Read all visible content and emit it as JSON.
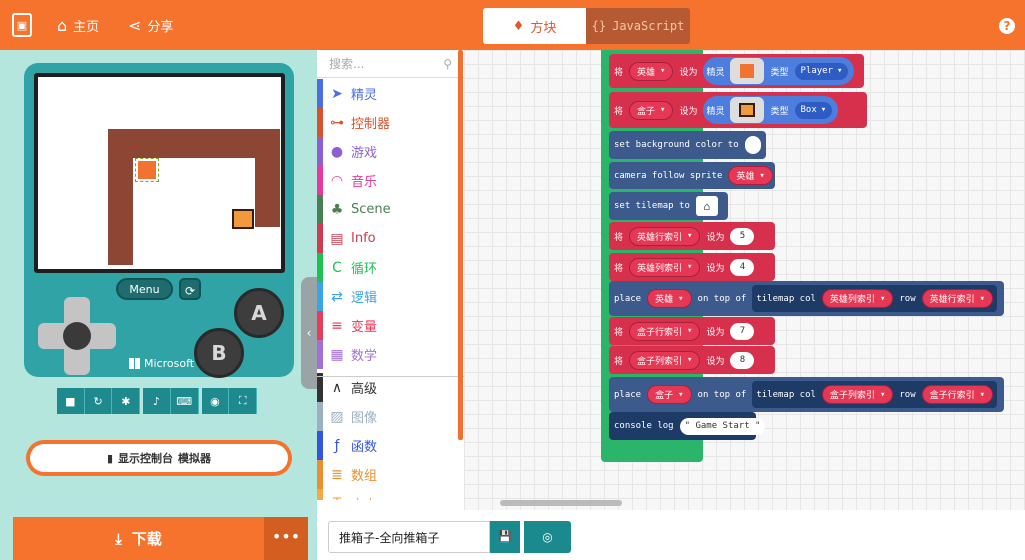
{
  "header": {
    "home_label": "主页",
    "share_label": "分享",
    "tab_blocks": "方块",
    "tab_js": "JavaScript",
    "tab_js_icon": "{}",
    "help": "?"
  },
  "simulator": {
    "menu_label": "Menu",
    "a_label": "A",
    "b_label": "B",
    "brand": "Microsoft",
    "console_label": "显示控制台",
    "console_sub": "模拟器",
    "download_label": "下载",
    "more_label": "•••"
  },
  "toolbox": {
    "search_placeholder": "搜索...",
    "categories": [
      {
        "label": "精灵",
        "color": "#4b6fe0"
      },
      {
        "label": "控制器",
        "color": "#d5542f"
      },
      {
        "label": "游戏",
        "color": "#8d5fd3"
      },
      {
        "label": "音乐",
        "color": "#e63a9a"
      },
      {
        "label": "Scene",
        "color": "#4b7f52"
      },
      {
        "label": "Info",
        "color": "#cf3b4f"
      },
      {
        "label": "循环",
        "color": "#20bf55"
      },
      {
        "label": "逻辑",
        "color": "#3ba3e6"
      },
      {
        "label": "变量",
        "color": "#e53e5c"
      },
      {
        "label": "数学",
        "color": "#a470d6"
      },
      {
        "label": "高级",
        "color": "#333333"
      },
      {
        "label": "图像",
        "color": "#9bb0c2"
      },
      {
        "label": "函数",
        "color": "#3455db"
      },
      {
        "label": "数组",
        "color": "#e88f31"
      },
      {
        "label": "文本",
        "color": "#f5a742"
      }
    ]
  },
  "workspace": {
    "set_kw": "将",
    "to_kw": "设为",
    "sprite_kw": "精灵",
    "type_kw": "类型",
    "hero_var": "英雄",
    "box_var": "盒子",
    "player_type": "Player",
    "box_type": "Box",
    "bg_color_label": "set background color to",
    "camera_label": "camera follow sprite",
    "tilemap_label": "set tilemap to",
    "hero_row_var": "英雄行索引",
    "hero_col_var": "英雄列索引",
    "box_row_var": "盒子行索引",
    "box_col_var": "盒子列索引",
    "hero_row_val": "5",
    "hero_col_val": "4",
    "box_row_val": "7",
    "box_col_val": "8",
    "place_kw": "place",
    "ontop_kw": "on top of",
    "tilemapcol_kw": "tilemap col",
    "row_kw": "row",
    "console_log_label": "console log",
    "game_start": "\" Game Start \""
  },
  "footer": {
    "project_name": "推箱子-全向推箱子"
  }
}
